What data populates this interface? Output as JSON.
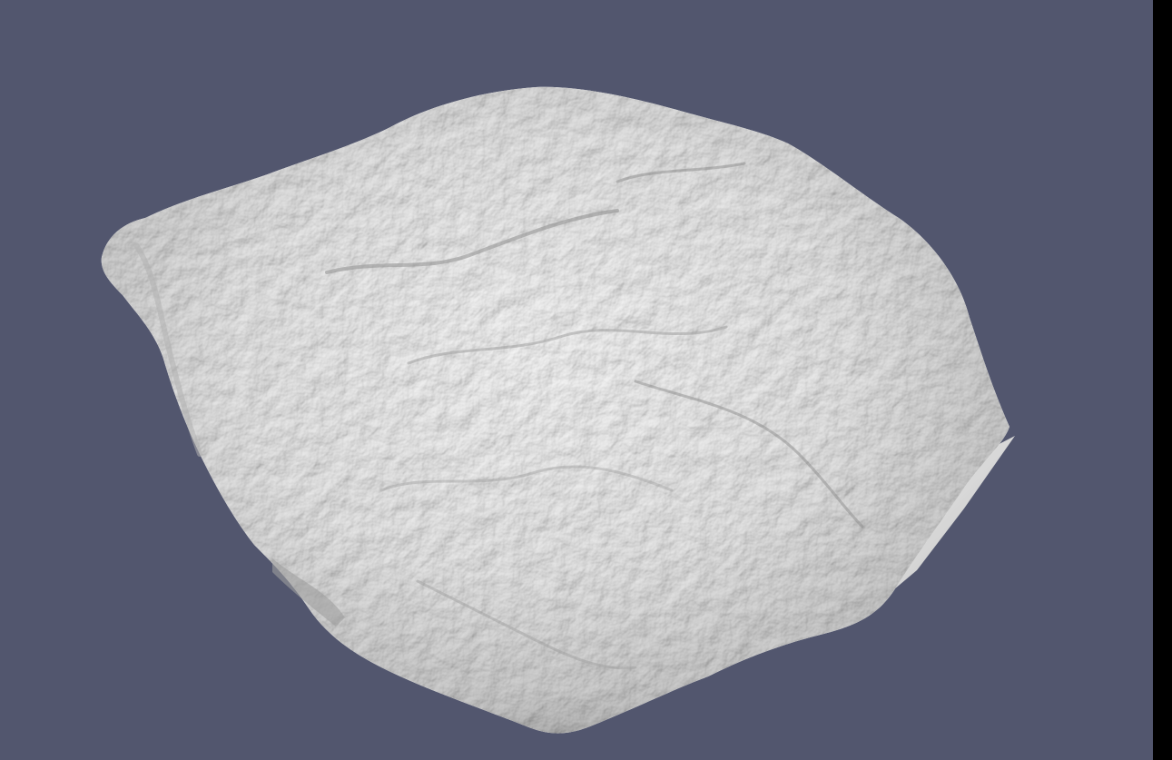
{
  "viewport": {
    "background_color": "#52566e",
    "model_color": "#e6e6e6",
    "right_strip_color": "#000000"
  }
}
